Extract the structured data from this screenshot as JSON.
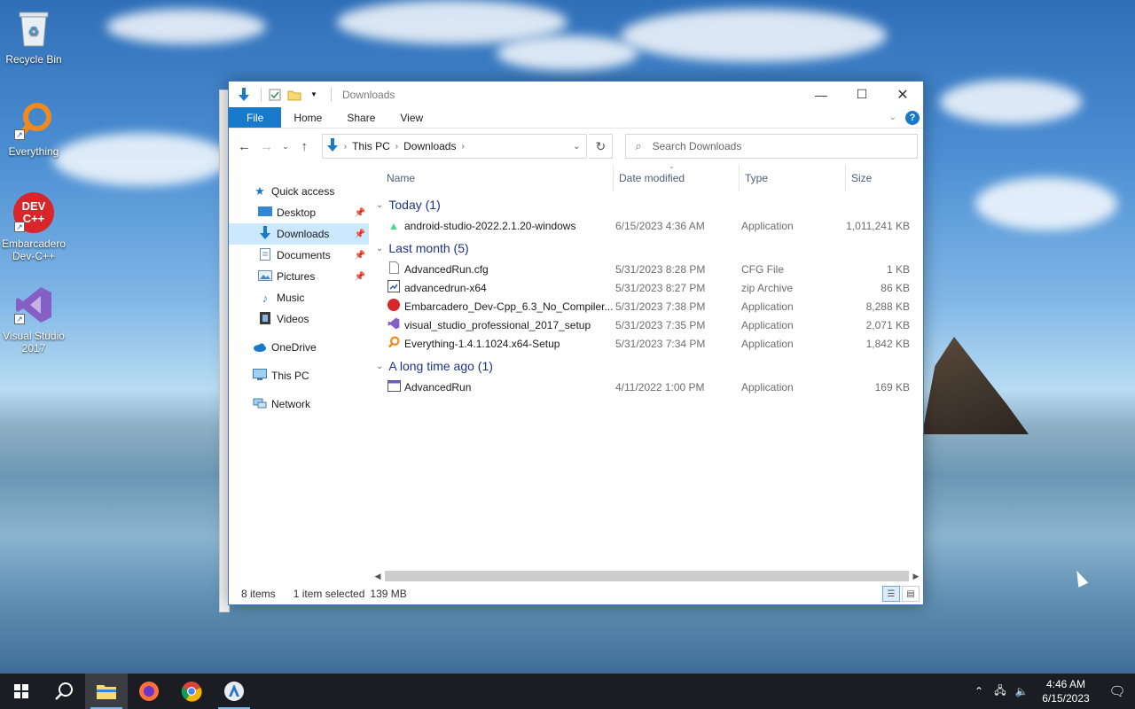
{
  "desktop": {
    "icons": [
      {
        "label": "Recycle Bin"
      },
      {
        "label": "Everything"
      },
      {
        "label": "Embarcadero Dev-C++",
        "badge": "DEV C++"
      },
      {
        "label": "Visual Studio 2017"
      }
    ]
  },
  "window": {
    "title": "Downloads",
    "ribbon_tabs": [
      "File",
      "Home",
      "Share",
      "View"
    ],
    "breadcrumb": [
      "This PC",
      "Downloads"
    ],
    "search_placeholder": "Search Downloads"
  },
  "nav": {
    "quick_access": "Quick access",
    "items": [
      "Desktop",
      "Downloads",
      "Documents",
      "Pictures",
      "Music",
      "Videos"
    ],
    "onedrive": "OneDrive",
    "this_pc": "This PC",
    "network": "Network"
  },
  "columns": {
    "name": "Name",
    "date": "Date modified",
    "type": "Type",
    "size": "Size"
  },
  "groups": [
    {
      "label": "Today (1)",
      "files": [
        {
          "name": "android-studio-2022.2.1.20-windows",
          "date": "6/15/2023 4:36 AM",
          "type": "Application",
          "size": "1,011,241 KB"
        }
      ]
    },
    {
      "label": "Last month (5)",
      "files": [
        {
          "name": "AdvancedRun.cfg",
          "date": "5/31/2023 8:28 PM",
          "type": "CFG File",
          "size": "1 KB"
        },
        {
          "name": "advancedrun-x64",
          "date": "5/31/2023 8:27 PM",
          "type": "zip Archive",
          "size": "86 KB"
        },
        {
          "name": "Embarcadero_Dev-Cpp_6.3_No_Compiler...",
          "date": "5/31/2023 7:38 PM",
          "type": "Application",
          "size": "8,288 KB"
        },
        {
          "name": "visual_studio_professional_2017_setup",
          "date": "5/31/2023 7:35 PM",
          "type": "Application",
          "size": "2,071 KB"
        },
        {
          "name": "Everything-1.4.1.1024.x64-Setup",
          "date": "5/31/2023 7:34 PM",
          "type": "Application",
          "size": "1,842 KB"
        }
      ]
    },
    {
      "label": "A long time ago (1)",
      "files": [
        {
          "name": "AdvancedRun",
          "date": "4/11/2022 1:00 PM",
          "type": "Application",
          "size": "169 KB"
        }
      ]
    }
  ],
  "status": {
    "items": "8 items",
    "selected": "1 item selected",
    "size": "139 MB"
  },
  "taskbar": {
    "time": "4:46 AM",
    "date": "6/15/2023"
  }
}
